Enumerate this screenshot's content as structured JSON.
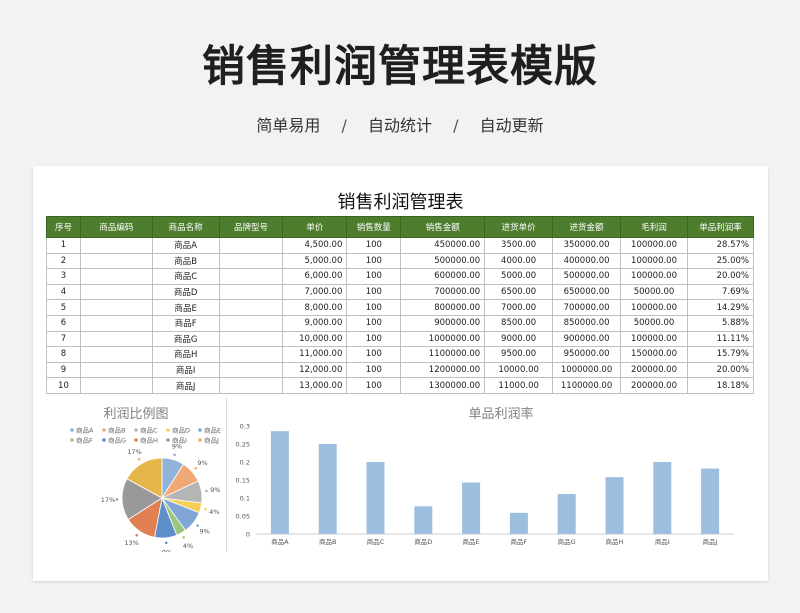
{
  "header": {
    "title": "销售利润管理表模版",
    "tags": [
      "简单易用",
      "自动统计",
      "自动更新"
    ],
    "separator": "/"
  },
  "sheet": {
    "title": "销售利润管理表",
    "columns": [
      "序号",
      "商品编码",
      "商品名称",
      "品牌型号",
      "单价",
      "销售数量",
      "销售金额",
      "进货单价",
      "进货金额",
      "毛利润",
      "单品利润率"
    ],
    "rows": [
      [
        "1",
        "",
        "商品A",
        "",
        "4,500.00",
        "100",
        "450000.00",
        "3500.00",
        "350000.00",
        "100000.00",
        "28.57%"
      ],
      [
        "2",
        "",
        "商品B",
        "",
        "5,000.00",
        "100",
        "500000.00",
        "4000.00",
        "400000.00",
        "100000.00",
        "25.00%"
      ],
      [
        "3",
        "",
        "商品C",
        "",
        "6,000.00",
        "100",
        "600000.00",
        "5000.00",
        "500000.00",
        "100000.00",
        "20.00%"
      ],
      [
        "4",
        "",
        "商品D",
        "",
        "7,000.00",
        "100",
        "700000.00",
        "6500.00",
        "650000.00",
        "50000.00",
        "7.69%"
      ],
      [
        "5",
        "",
        "商品E",
        "",
        "8,000.00",
        "100",
        "800000.00",
        "7000.00",
        "700000.00",
        "100000.00",
        "14.29%"
      ],
      [
        "6",
        "",
        "商品F",
        "",
        "9,000.00",
        "100",
        "900000.00",
        "8500.00",
        "850000.00",
        "50000.00",
        "5.88%"
      ],
      [
        "7",
        "",
        "商品G",
        "",
        "10,000.00",
        "100",
        "1000000.00",
        "9000.00",
        "900000.00",
        "100000.00",
        "11.11%"
      ],
      [
        "8",
        "",
        "商品H",
        "",
        "11,000.00",
        "100",
        "1100000.00",
        "9500.00",
        "950000.00",
        "150000.00",
        "15.79%"
      ],
      [
        "9",
        "",
        "商品I",
        "",
        "12,000.00",
        "100",
        "1200000.00",
        "10000.00",
        "1000000.00",
        "200000.00",
        "20.00%"
      ],
      [
        "10",
        "",
        "商品J",
        "",
        "13,000.00",
        "100",
        "1300000.00",
        "11000.00",
        "1100000.00",
        "200000.00",
        "18.18%"
      ]
    ]
  },
  "chart_data": [
    {
      "type": "pie",
      "title": "利润比例图",
      "categories": [
        "商品A",
        "商品B",
        "商品C",
        "商品D",
        "商品E",
        "商品F",
        "商品G",
        "商品H",
        "商品I",
        "商品J"
      ],
      "values": [
        9,
        9,
        9,
        4,
        9,
        4,
        9,
        13,
        17,
        17
      ],
      "data_labels": [
        "9%",
        "9%",
        "9%",
        "4%",
        "9%",
        "4%",
        "9%",
        "13%",
        "17%",
        "17%"
      ],
      "colors": [
        "#8fb3d9",
        "#f0a875",
        "#b5b5b5",
        "#f5cf5a",
        "#7fa6d6",
        "#9cc57f",
        "#5f8fc8",
        "#e07f52",
        "#999999",
        "#e6b64a"
      ],
      "legend": "top"
    },
    {
      "type": "bar",
      "title": "单品利润率",
      "categories": [
        "商品A",
        "商品B",
        "商品C",
        "商品D",
        "商品E",
        "商品F",
        "商品G",
        "商品H",
        "商品I",
        "商品J"
      ],
      "values": [
        0.2857,
        0.25,
        0.2,
        0.0769,
        0.1429,
        0.0588,
        0.1111,
        0.1579,
        0.2,
        0.1818
      ],
      "ylim": [
        0,
        0.3
      ],
      "yticks": [
        "0",
        "0.05",
        "0.1",
        "0.15",
        "0.2",
        "0.25",
        "0.3"
      ],
      "color": "#9dbfdf",
      "grid": false
    }
  ]
}
